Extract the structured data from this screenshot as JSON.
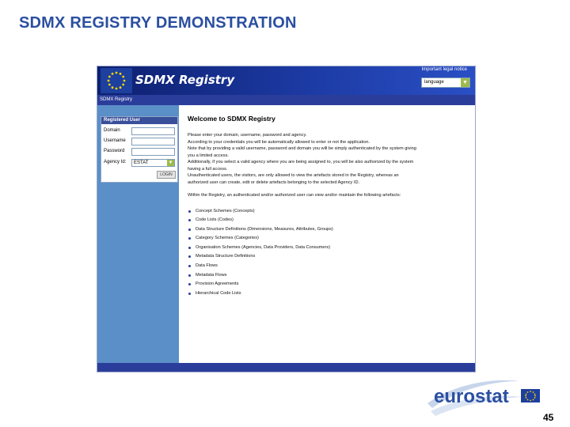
{
  "slide": {
    "title": "SDMX REGISTRY DEMONSTRATION",
    "page_number": "45",
    "logo_text": "eurostat"
  },
  "app": {
    "banner_title": "SDMX Registry",
    "legal_link": "Important legal notice",
    "language_select": "language",
    "breadcrumb": "SDMX Registry"
  },
  "login": {
    "header": "Registered User",
    "domain_label": "Domain",
    "username_label": "Username",
    "password_label": "Password",
    "agency_label": "Agency Id:",
    "agency_value": "ESTAT",
    "login_button": "LOGIN"
  },
  "content": {
    "heading": "Welcome to SDMX Registry",
    "paragraphs": [
      "Please enter your domain, username, password and agency.",
      "According to your credentials you will be automatically allowed to enter or not the application.",
      "Note that by providing a valid username, password and domain you will be simply authenticated by the system giving",
      "you a limited access.",
      "Additionally, if you select a valid agency where you are being assigned to, you will be also authorized by the system",
      "having a full access.",
      "Unauthenticated users, the visitors, are only allowed to view the artefacts stored in the Registry, whereas an",
      "authorized user can create, edit or delete artefacts belonging to the selected Agency ID."
    ],
    "intro": "Within the Registry, an authenticated and/or authorized user can view and/or maintain the following artefacts:",
    "artefacts": [
      "Concept Schemes (Concepts)",
      "Code Lists (Codes)",
      "Data Structure Definitions (Dimensions, Measures, Attributes, Groups)",
      "Category Schemes (Categories)",
      "Organisation Schemes (Agencies, Data Providers, Data Consumers)",
      "Metadata Structure Definitions",
      "Data Flows",
      "Metadata Flows",
      "Provision Agreements",
      "Hierarchical Code Lists"
    ]
  },
  "colors": {
    "title_blue": "#2b4fa0",
    "banner_dark": "#0d1f6e",
    "sidebar_blue": "#5a8fc7",
    "nav_bar": "#2b3d9a",
    "eu_yellow": "#ffd700"
  }
}
